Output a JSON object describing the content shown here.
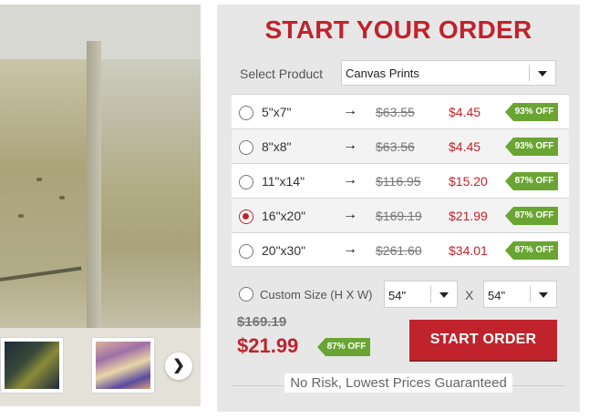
{
  "hero": {
    "next_icon": "chevron-right-icon",
    "next_glyph": "❯"
  },
  "order": {
    "title": "START YOUR ORDER",
    "select_label": "Select Product",
    "select_value": "Canvas Prints",
    "arrow_glyph": "→",
    "options": [
      {
        "size": "5\"x7\"",
        "old_price": "$63.55",
        "new_price": "$4.45",
        "badge": "93% OFF",
        "selected": false
      },
      {
        "size": "8\"x8\"",
        "old_price": "$63.56",
        "new_price": "$4.45",
        "badge": "93% OFF",
        "selected": false
      },
      {
        "size": "11\"x14\"",
        "old_price": "$116.95",
        "new_price": "$15.20",
        "badge": "87% OFF",
        "selected": false
      },
      {
        "size": "16\"x20\"",
        "old_price": "$169.19",
        "new_price": "$21.99",
        "badge": "87% OFF",
        "selected": true
      },
      {
        "size": "20\"x30\"",
        "old_price": "$261.60",
        "new_price": "$34.01",
        "badge": "87% OFF",
        "selected": false
      }
    ],
    "custom": {
      "label": "Custom Size (H X W)",
      "height_value": "54\"",
      "width_value": "54\"",
      "times": "X"
    },
    "summary": {
      "old_price": "$169.19",
      "new_price": "$21.99",
      "badge": "87% OFF"
    },
    "start_button": "START ORDER",
    "guarantee": "No Risk, Lowest Prices Guaranteed"
  },
  "colors": {
    "brand_red": "#c0232c",
    "badge_green": "#6aa533",
    "panel_bg": "#e7e7e7"
  }
}
